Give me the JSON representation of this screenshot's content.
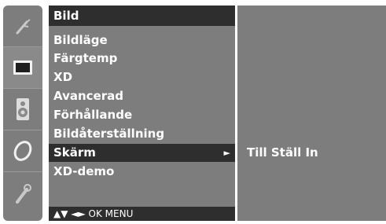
{
  "menu": {
    "title": "Bild",
    "items": [
      {
        "label": "Bildläge"
      },
      {
        "label": "Färgtemp"
      },
      {
        "label": "XD"
      },
      {
        "label": "Avancerad"
      },
      {
        "label": "Förhållande"
      },
      {
        "label": "Bildåterställning"
      },
      {
        "label": "Skärm",
        "selected": true,
        "arrow": "►"
      },
      {
        "label": "XD-demo"
      }
    ],
    "footer": "▲▼ ◄► OK  MENU"
  },
  "submenu": {
    "item": "Till Ställ In"
  },
  "iconbar": {
    "icons": [
      "antenna-icon",
      "picture-icon",
      "speaker-icon",
      "clock-icon",
      "key-icon"
    ],
    "active": "picture-icon"
  }
}
